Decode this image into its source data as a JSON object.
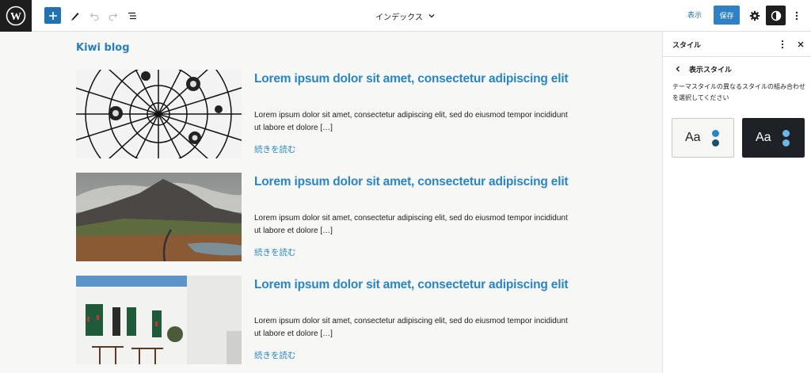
{
  "toolbar": {
    "document_title": "インデックス",
    "preview_label": "表示",
    "save_label": "保存"
  },
  "canvas": {
    "site_title": "Kiwi blog",
    "posts": [
      {
        "title": "Lorem ipsum dolor sit amet, consectetur adipiscing elit",
        "excerpt": "Lorem ipsum dolor sit amet, consectetur adipiscing elit, sed do eiusmod tempor incididunt ut labore et dolore […]",
        "read_more": "続きを読む",
        "image": "ceiling-architecture-photo"
      },
      {
        "title": "Lorem ipsum dolor sit amet, consectetur adipiscing elit",
        "excerpt": "Lorem ipsum dolor sit amet, consectetur adipiscing elit, sed do eiusmod tempor incididunt ut labore et dolore […]",
        "read_more": "続きを読む",
        "image": "mountain-landscape-photo"
      },
      {
        "title": "Lorem ipsum dolor sit amet, consectetur adipiscing elit",
        "excerpt": "Lorem ipsum dolor sit amet, consectetur adipiscing elit, sed do eiusmod tempor incididunt ut labore et dolore […]",
        "read_more": "続きを読む",
        "image": "white-building-cafe-photo"
      }
    ]
  },
  "sidebar": {
    "title": "スタイル",
    "subtitle": "表示スタイル",
    "description": "テーマスタイルの異なるスタイルの組み合わせを選択してください",
    "variations": [
      {
        "label": "Aa",
        "background": "#f7f7f5",
        "text_color": "#1e1e1e",
        "dot_colors": [
          "#2a85c2",
          "#1e4e6e"
        ]
      },
      {
        "label": "Aa",
        "background": "#1e2227",
        "text_color": "#ffffff",
        "dot_colors": [
          "#6ab8e8",
          "#6ab8e8"
        ]
      }
    ]
  },
  "colors": {
    "accent": "#2a85c2",
    "primary_button": "#2f80c4",
    "dark": "#1e1e1e",
    "canvas_bg": "#f7f7f5"
  },
  "icons": [
    "wordpress-logo-icon",
    "plus-icon",
    "pen-icon",
    "undo-icon",
    "redo-icon",
    "list-view-icon",
    "chevron-down-icon",
    "gear-icon",
    "half-circle-contrast-icon",
    "vertical-ellipsis-icon",
    "close-icon",
    "chevron-left-icon"
  ]
}
